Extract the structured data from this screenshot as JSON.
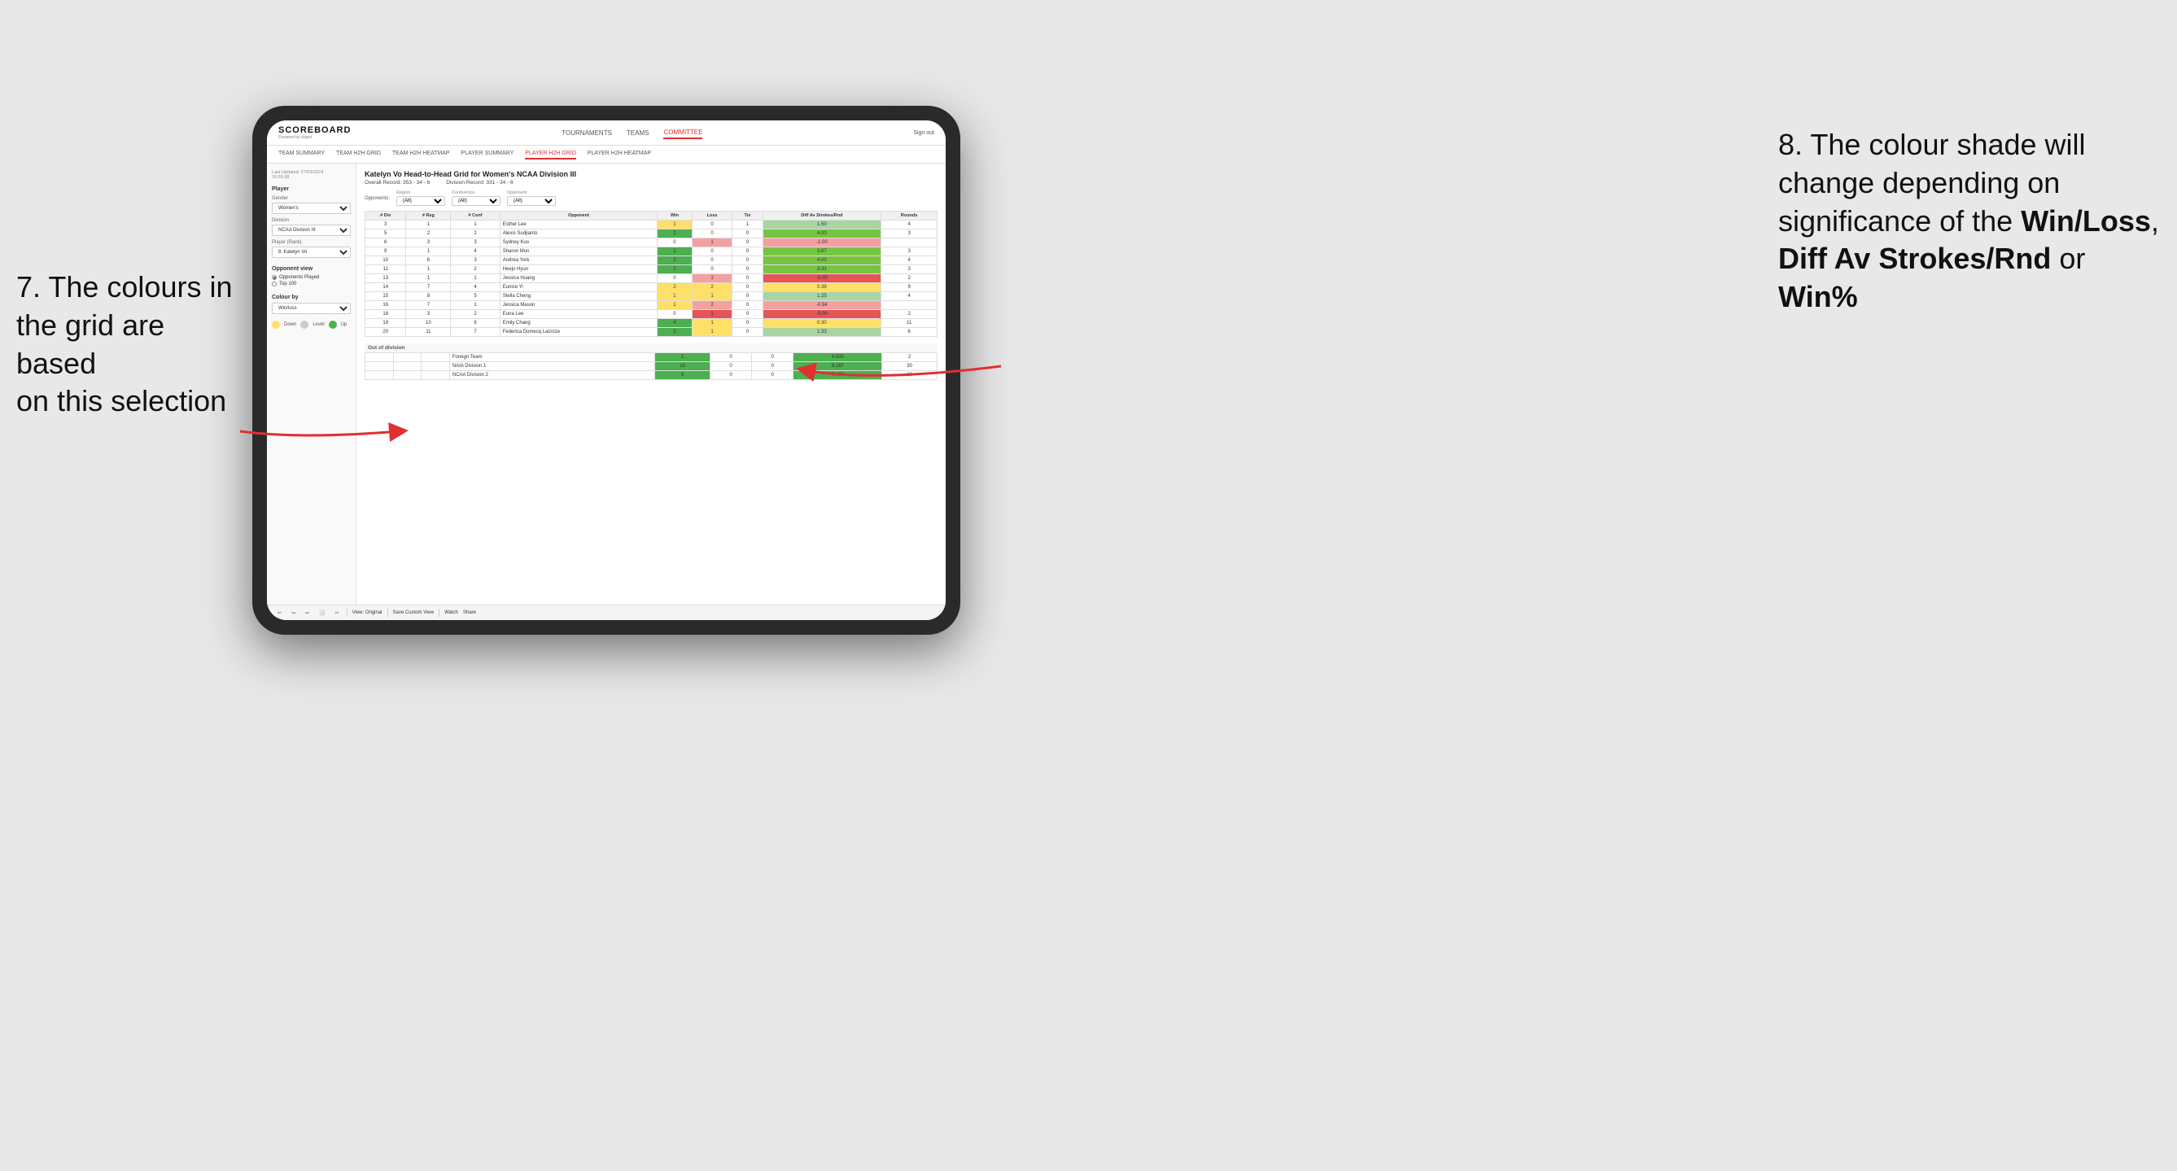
{
  "annotation_left": {
    "line1": "7. The colours in",
    "line2": "the grid are based",
    "line3": "on this selection"
  },
  "annotation_right": {
    "prefix": "8. The colour shade will change depending on significance of the ",
    "bold1": "Win/Loss",
    "mid": ", ",
    "bold2": "Diff Av Strokes/Rnd",
    "suffix": " or ",
    "bold3": "Win%"
  },
  "nav": {
    "logo": "SCOREBOARD",
    "logo_sub": "Powered by clippd",
    "links": [
      "TOURNAMENTS",
      "TEAMS",
      "COMMITTEE"
    ],
    "active_link": "COMMITTEE",
    "sign_out": "Sign out"
  },
  "secondary_nav": {
    "links": [
      "TEAM SUMMARY",
      "TEAM H2H GRID",
      "TEAM H2H HEATMAP",
      "PLAYER SUMMARY",
      "PLAYER H2H GRID",
      "PLAYER H2H HEATMAP"
    ],
    "active_link": "PLAYER H2H GRID"
  },
  "sidebar": {
    "timestamp_label": "Last Updated: 27/03/2024",
    "timestamp_time": "16:55:38",
    "player_section": "Player",
    "gender_label": "Gender",
    "gender_value": "Women's",
    "division_label": "Division",
    "division_value": "NCAA Division III",
    "player_rank_label": "Player (Rank)",
    "player_rank_value": "8. Katelyn Vo",
    "opponent_view_title": "Opponent view",
    "radio_opponents": "Opponents Played",
    "radio_top100": "Top 100",
    "colour_by_title": "Colour by",
    "colour_by_value": "Win/loss",
    "legend_down": "Down",
    "legend_level": "Level",
    "legend_up": "Up"
  },
  "grid": {
    "title": "Katelyn Vo Head-to-Head Grid for Women's NCAA Division III",
    "overall_record_label": "Overall Record:",
    "overall_record": "353 - 34 - 6",
    "division_record_label": "Division Record:",
    "division_record": "331 - 34 - 6",
    "region_label": "Region",
    "region_value": "(All)",
    "conference_label": "Conference",
    "conference_value": "(All)",
    "opponent_label": "Opponent",
    "opponent_value": "(All)",
    "opponents_label": "Opponents:",
    "columns": {
      "div": "# Div",
      "reg": "# Reg",
      "conf": "# Conf",
      "opponent": "Opponent",
      "win": "Win",
      "loss": "Loss",
      "tie": "Tie",
      "diff_av": "Diff Av Strokes/Rnd",
      "rounds": "Rounds"
    },
    "rows": [
      {
        "div": "3",
        "reg": "1",
        "conf": "1",
        "opponent": "Esther Lee",
        "win": 1,
        "loss": 0,
        "tie": 1,
        "diff_av": "1.50",
        "rounds": "4",
        "win_color": "yellow",
        "loss_color": "white",
        "diff_color": "green_light"
      },
      {
        "div": "5",
        "reg": "2",
        "conf": "2",
        "opponent": "Alexis Sudjianto",
        "win": 1,
        "loss": 0,
        "tie": 0,
        "diff_av": "4.00",
        "rounds": "3",
        "win_color": "green_dark",
        "loss_color": "white",
        "diff_color": "green_medium"
      },
      {
        "div": "6",
        "reg": "3",
        "conf": "3",
        "opponent": "Sydney Kuo",
        "win": 0,
        "loss": 1,
        "tie": 0,
        "diff_av": "-1.00",
        "rounds": "",
        "win_color": "white",
        "loss_color": "red_light",
        "diff_color": "red_light"
      },
      {
        "div": "9",
        "reg": "1",
        "conf": "4",
        "opponent": "Sharon Mun",
        "win": 1,
        "loss": 0,
        "tie": 0,
        "diff_av": "3.67",
        "rounds": "3",
        "win_color": "green_dark",
        "loss_color": "white",
        "diff_color": "green_medium"
      },
      {
        "div": "10",
        "reg": "6",
        "conf": "3",
        "opponent": "Andrea York",
        "win": 2,
        "loss": 0,
        "tie": 0,
        "diff_av": "4.00",
        "rounds": "4",
        "win_color": "green_dark",
        "loss_color": "white",
        "diff_color": "green_medium"
      },
      {
        "div": "11",
        "reg": "1",
        "conf": "2",
        "opponent": "Heejo Hyun",
        "win": 1,
        "loss": 0,
        "tie": 0,
        "diff_av": "3.33",
        "rounds": "3",
        "win_color": "green_dark",
        "loss_color": "white",
        "diff_color": "green_medium"
      },
      {
        "div": "13",
        "reg": "1",
        "conf": "1",
        "opponent": "Jessica Huang",
        "win": 0,
        "loss": 1,
        "tie": 0,
        "diff_av": "-3.00",
        "rounds": "2",
        "win_color": "white",
        "loss_color": "red_light",
        "diff_color": "red_medium"
      },
      {
        "div": "14",
        "reg": "7",
        "conf": "4",
        "opponent": "Eunice Yi",
        "win": 2,
        "loss": 2,
        "tie": 0,
        "diff_av": "0.38",
        "rounds": "9",
        "win_color": "yellow",
        "loss_color": "yellow",
        "diff_color": "yellow"
      },
      {
        "div": "15",
        "reg": "8",
        "conf": "5",
        "opponent": "Stella Cheng",
        "win": 1,
        "loss": 1,
        "tie": 0,
        "diff_av": "1.25",
        "rounds": "4",
        "win_color": "yellow",
        "loss_color": "yellow",
        "diff_color": "green_light"
      },
      {
        "div": "16",
        "reg": "7",
        "conf": "1",
        "opponent": "Jessica Mason",
        "win": 1,
        "loss": 2,
        "tie": 0,
        "diff_av": "-0.94",
        "rounds": "",
        "win_color": "yellow",
        "loss_color": "red_light",
        "diff_color": "red_light"
      },
      {
        "div": "18",
        "reg": "3",
        "conf": "2",
        "opponent": "Euna Lee",
        "win": 0,
        "loss": 1,
        "tie": 0,
        "diff_av": "-5.00",
        "rounds": "2",
        "win_color": "white",
        "loss_color": "red_medium",
        "diff_color": "red_medium"
      },
      {
        "div": "19",
        "reg": "10",
        "conf": "6",
        "opponent": "Emily Chang",
        "win": 4,
        "loss": 1,
        "tie": 0,
        "diff_av": "0.30",
        "rounds": "11",
        "win_color": "green_dark",
        "loss_color": "yellow",
        "diff_color": "yellow"
      },
      {
        "div": "20",
        "reg": "11",
        "conf": "7",
        "opponent": "Federica Domecq Lacroze",
        "win": 2,
        "loss": 1,
        "tie": 0,
        "diff_av": "1.33",
        "rounds": "6",
        "win_color": "green_dark",
        "loss_color": "yellow",
        "diff_color": "green_light"
      }
    ],
    "out_of_division": {
      "label": "Out of division",
      "rows": [
        {
          "label": "Foreign Team",
          "win": 1,
          "loss": 0,
          "tie": 0,
          "diff_av": "4.500",
          "rounds": "2",
          "win_color": "green_dark"
        },
        {
          "label": "NAIA Division 1",
          "win": 15,
          "loss": 0,
          "tie": 0,
          "diff_av": "9.267",
          "rounds": "30",
          "win_color": "green_dark"
        },
        {
          "label": "NCAA Division 2",
          "win": 5,
          "loss": 0,
          "tie": 0,
          "diff_av": "7.400",
          "rounds": "10",
          "win_color": "green_dark"
        }
      ]
    }
  },
  "toolbar": {
    "view_original": "View: Original",
    "save_custom": "Save Custom View",
    "watch": "Watch",
    "share": "Share"
  }
}
